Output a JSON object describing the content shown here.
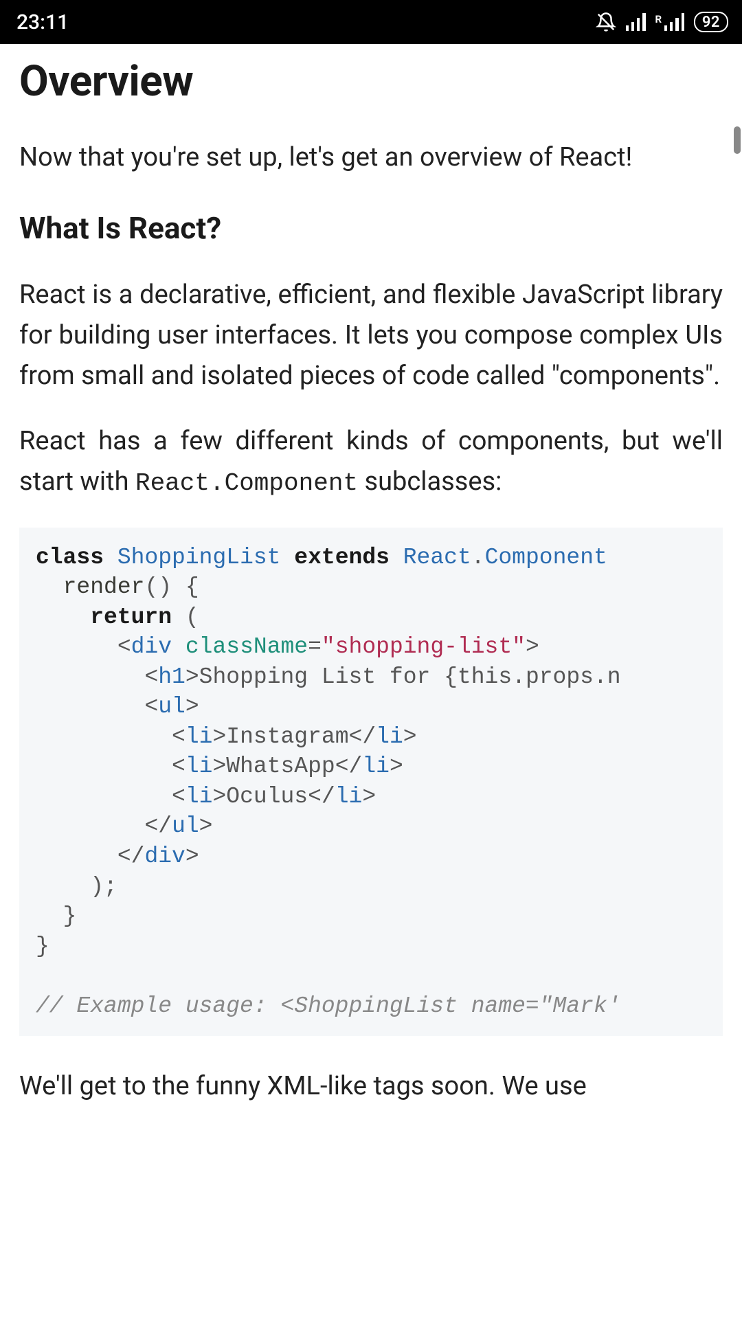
{
  "status": {
    "time": "23:11",
    "battery": "92",
    "roaming_label": "R"
  },
  "page": {
    "title": "Overview",
    "intro": "Now that you're set up, let's get an overview of React!",
    "section_heading": "What Is React?",
    "p1": "React is a declarative, efficient, and flexible JavaScript library for building user interfaces. It lets you compose complex UIs from small and isolated pieces of code called \"components\".",
    "p2_a": "React has a few different kinds of components, but we'll start with ",
    "p2_code": "React.Component",
    "p2_b": " subclasses:",
    "after": "We'll get to the funny XML-like tags soon. We use"
  },
  "code": {
    "kw_class": "class",
    "cls_name": "ShoppingList",
    "kw_extends": "extends",
    "cls_react": "React",
    "dot": ".",
    "cls_comp": "Component",
    "line2_indent": "  ",
    "fn_render": "render",
    "parens": "()",
    "space": " ",
    "brace_open": "{",
    "line3_indent": "    ",
    "kw_return": "return",
    "paren_open": "(",
    "line4_indent": "      ",
    "lt": "<",
    "tag_div": "div",
    "attr_className": "className",
    "eq": "=",
    "str_shopping": "\"shopping-list\"",
    "gt": ">",
    "line5_indent": "        ",
    "tag_h1": "h1",
    "txt_h1": "Shopping List for {this.props.n",
    "line6_indent": "        ",
    "tag_ul": "ul",
    "line7_indent": "          ",
    "tag_li": "li",
    "txt_ig": "Instagram",
    "slash": "/",
    "txt_wa": "WhatsApp",
    "txt_oc": "Oculus",
    "line10_indent": "        ",
    "line11_indent": "      ",
    "line12_indent": "    ",
    "paren_close": ")",
    "semi": ";",
    "line13_indent": "  ",
    "brace_close": "}",
    "comment": "// Example usage: <ShoppingList name=\"Mark'"
  }
}
